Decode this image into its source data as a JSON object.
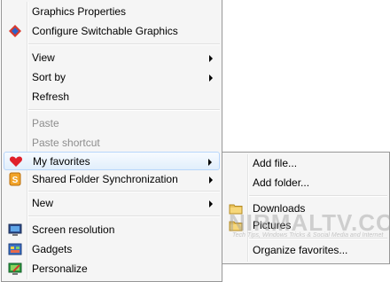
{
  "main_menu": {
    "graphics_properties": "Graphics Properties",
    "configure_switchable_graphics": "Configure Switchable Graphics",
    "view": "View",
    "sort_by": "Sort by",
    "refresh": "Refresh",
    "paste": "Paste",
    "paste_shortcut": "Paste shortcut",
    "my_favorites": "My favorites",
    "shared_folder_sync": "Shared Folder Synchronization",
    "new": "New",
    "screen_resolution": "Screen resolution",
    "gadgets": "Gadgets",
    "personalize": "Personalize"
  },
  "favorites_submenu": {
    "add_file": "Add file...",
    "add_folder": "Add folder...",
    "downloads": "Downloads",
    "pictures": "Pictures",
    "organize_favorites": "Organize favorites..."
  },
  "watermark": {
    "title": "NIRMALTV.COM",
    "subtitle": "Tech Tips, Windows Tricks & Social Media and Internet"
  },
  "icons": {
    "configure": "switchable-graphics-icon",
    "favorites": "heart-icon",
    "shared_folder": "sync-icon",
    "screen_resolution": "monitor-icon",
    "gadgets": "gadgets-icon",
    "personalize": "personalize-icon",
    "folder": "folder-icon"
  },
  "colors": {
    "highlight_border": "#b8d6fb",
    "disabled_text": "#8d8d8d",
    "menu_bg": "#f5f5f5"
  }
}
